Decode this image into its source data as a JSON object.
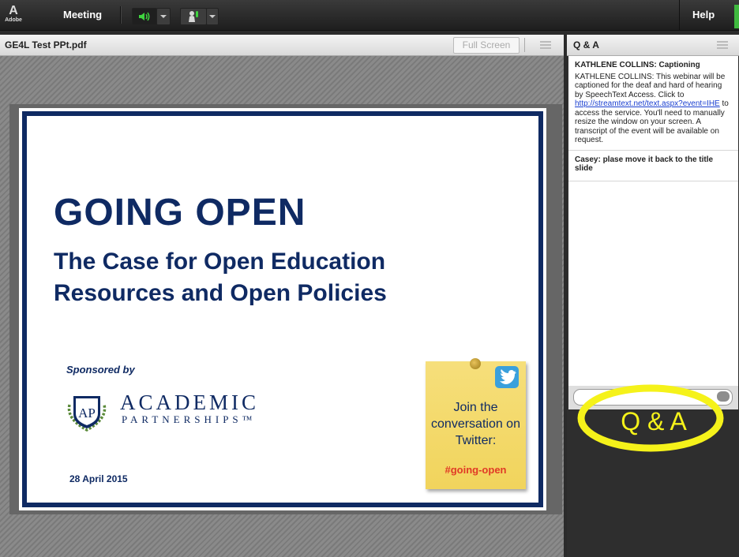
{
  "app": {
    "logo_text": "A",
    "logo_sub": "Adobe",
    "menu_meeting": "Meeting",
    "help_label": "Help"
  },
  "share_pod": {
    "title": "GE4L Test PPt.pdf",
    "fullscreen_label": "Full Screen"
  },
  "slide": {
    "title": "GOING OPEN",
    "subtitle": "The Case for Open Education Resources and Open Policies",
    "sponsored": "Sponsored by",
    "logo_initials": "AP",
    "logo_word1": "ACADEMIC",
    "logo_word2": "PARTNERSHIPS™",
    "date": "28 April 2015",
    "sticky_text": "Join the conversation on Twitter:",
    "sticky_tag": "#going-open"
  },
  "qa_pod": {
    "title": "Q & A",
    "items": [
      {
        "heading": "KATHLENE COLLINS: Captioning",
        "text_before": "KATHLENE COLLINS: This webinar will be captioned for the deaf and hard of hearing by SpeechText Access. Click to ",
        "link": "http://streamtext.net/text.aspx?event=IHE",
        "text_after": " to access the service. You'll need to manually resize the window on your screen. A transcript of the event will be available on request."
      },
      {
        "heading": "Casey: plase move it back to the title slide"
      }
    ],
    "callout_label": "Q & A"
  },
  "colors": {
    "slide_navy": "#0f2a63",
    "callout_yellow": "#f5f21a",
    "speaker_green": "#3fd43f",
    "hashtag_red": "#e13a26"
  }
}
